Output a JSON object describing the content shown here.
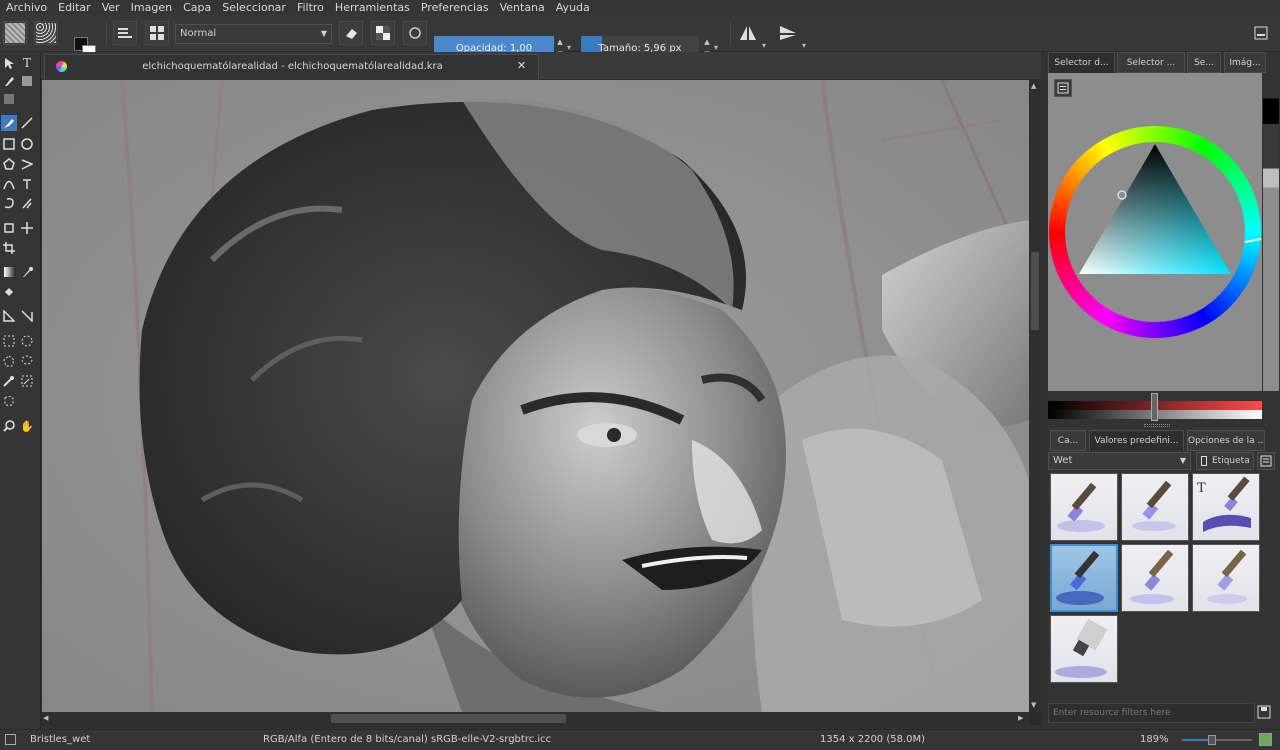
{
  "menu": [
    "Archivo",
    "Editar",
    "Ver",
    "Imagen",
    "Capa",
    "Seleccionar",
    "Filtro",
    "Herramientas",
    "Preferencias",
    "Ventana",
    "Ayuda"
  ],
  "toolbar": {
    "blend_mode": "Normal",
    "opacity_label": "Opacidad:",
    "opacity_value": "1,00",
    "size_label": "Tamaño:",
    "size_value": "5,96 px",
    "opacity_fraction": 1.0
  },
  "document": {
    "tab_title": "elchichoquematólarealidad - elchichoquematólarealidad.kra"
  },
  "dock": {
    "top_tabs": [
      "Selector d...",
      "Selector ...",
      "Se...",
      "Imág..."
    ],
    "bottom_tabs": [
      "Ca...",
      "Valores predefini...",
      "Opciones de la ..."
    ],
    "preset_tag": "Wet",
    "tag_label": "Etiqueta",
    "filter_placeholder": "Enter resource filters here"
  },
  "status": {
    "brush": "Bristles_wet",
    "color_model": "RGB/Alfa (Entero de 8 bits/canal)  sRGB-elle-V2-srgbtrc.icc",
    "dimensions": "1354 x 2200 (58.0M)",
    "zoom": "189%"
  },
  "colors": {
    "accent_blue": "#3d7bc0",
    "canvas_gray": "#8f8f8f"
  }
}
